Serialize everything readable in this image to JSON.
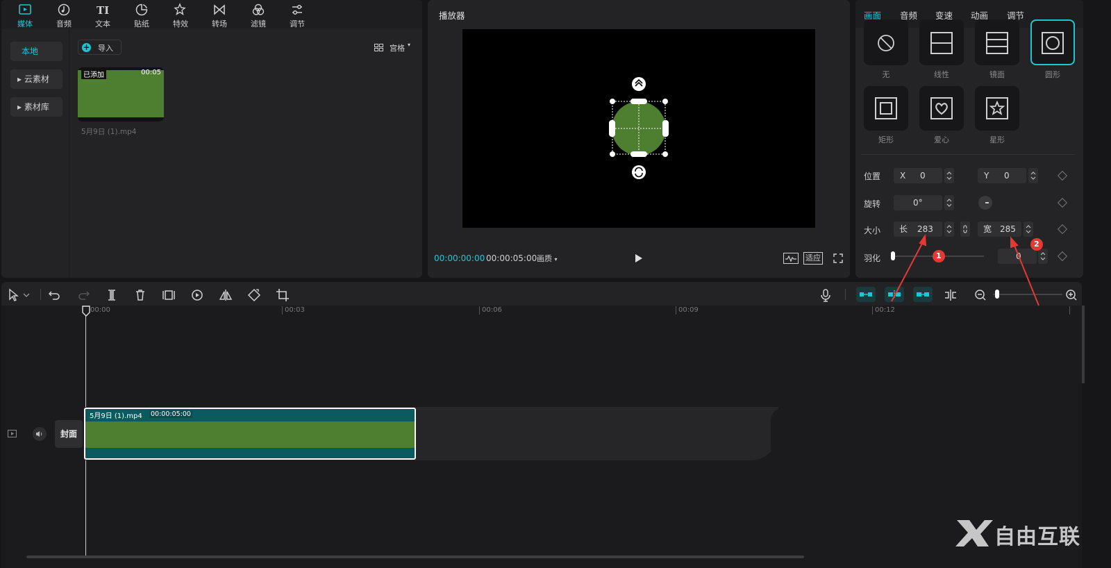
{
  "top_tabs": [
    {
      "label": "媒体",
      "icon": "media-icon"
    },
    {
      "label": "音频",
      "icon": "audio-icon"
    },
    {
      "label": "文本",
      "icon": "text-icon"
    },
    {
      "label": "贴纸",
      "icon": "sticker-icon"
    },
    {
      "label": "特效",
      "icon": "effects-icon"
    },
    {
      "label": "转场",
      "icon": "transition-icon"
    },
    {
      "label": "滤镜",
      "icon": "filter-icon"
    },
    {
      "label": "调节",
      "icon": "adjust-icon"
    }
  ],
  "media": {
    "sidebar": [
      "本地",
      "▸ 云素材",
      "▸ 素材库"
    ],
    "import_label": "导入",
    "view_label": "宫格",
    "clip": {
      "badge": "已添加",
      "duration": "00:05",
      "filename": "5月9日 (1).mp4"
    }
  },
  "player": {
    "title": "播放器",
    "current_time": "00:00:00:00",
    "total_time": "00:00:05:00",
    "quality_label": "画质",
    "fit_label": "适应"
  },
  "props": {
    "tabs": [
      "画面",
      "音频",
      "变速",
      "动画",
      "调节"
    ],
    "masks": [
      {
        "label": "无",
        "icon": "no-mask-icon"
      },
      {
        "label": "线性",
        "icon": "linear-mask-icon"
      },
      {
        "label": "镜面",
        "icon": "mirror-mask-icon"
      },
      {
        "label": "圆形",
        "icon": "circle-mask-icon"
      },
      {
        "label": "矩形",
        "icon": "rect-mask-icon"
      },
      {
        "label": "爱心",
        "icon": "heart-mask-icon"
      },
      {
        "label": "星形",
        "icon": "star-mask-icon"
      }
    ],
    "position_label": "位置",
    "x_label": "X",
    "x_value": "0",
    "y_label": "Y",
    "y_value": "0",
    "rotation_label": "旋转",
    "rotation_value": "0°",
    "size_label": "大小",
    "length_label": "长",
    "length_value": "283",
    "width_label": "宽",
    "width_value": "285",
    "feather_label": "羽化",
    "feather_value": "0",
    "annotations": [
      "1",
      "2"
    ]
  },
  "timeline": {
    "ruler": [
      "00:00",
      "00:03",
      "00:06",
      "00:09",
      "00:12"
    ],
    "track_cover_label": "封面",
    "clip_name": "5月9日 (1).mp4",
    "clip_duration": "00:00:05:00"
  },
  "watermark": {
    "text": "自由互联"
  },
  "colors": {
    "accent": "#1dc6d3",
    "clip_green": "#4e7f30",
    "clip_border": "#0a5a60",
    "annotation_red": "#e53935"
  }
}
